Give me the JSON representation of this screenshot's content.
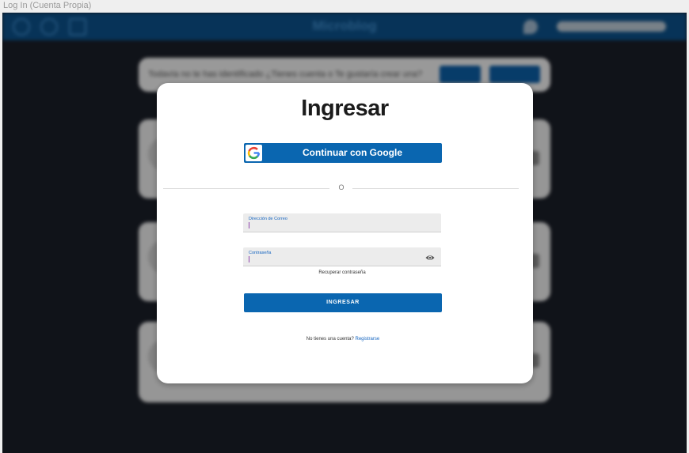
{
  "window": {
    "title": "Log In (Cuenta Propia)"
  },
  "background": {
    "brand": "Microblog",
    "banner_text": "Todavía no te has identificado ¿Tienes cuenta o Te gustaría crear una?"
  },
  "modal": {
    "title": "Ingresar",
    "google_button": "Continuar con Google",
    "divider": "O",
    "email_label": "Dirección de Correo",
    "password_label": "Contraseña",
    "recover_link": "Recuperar contraseña",
    "submit_button": "INGRESAR",
    "no_account_text": "No tienes una cuenta?",
    "register_link": "Registrarse"
  },
  "colors": {
    "accent": "#0a66b0",
    "topbar": "#0c4f87",
    "background": "#1a1e27"
  },
  "icons": {
    "google": "google-icon",
    "password_toggle": "eye-icon"
  }
}
